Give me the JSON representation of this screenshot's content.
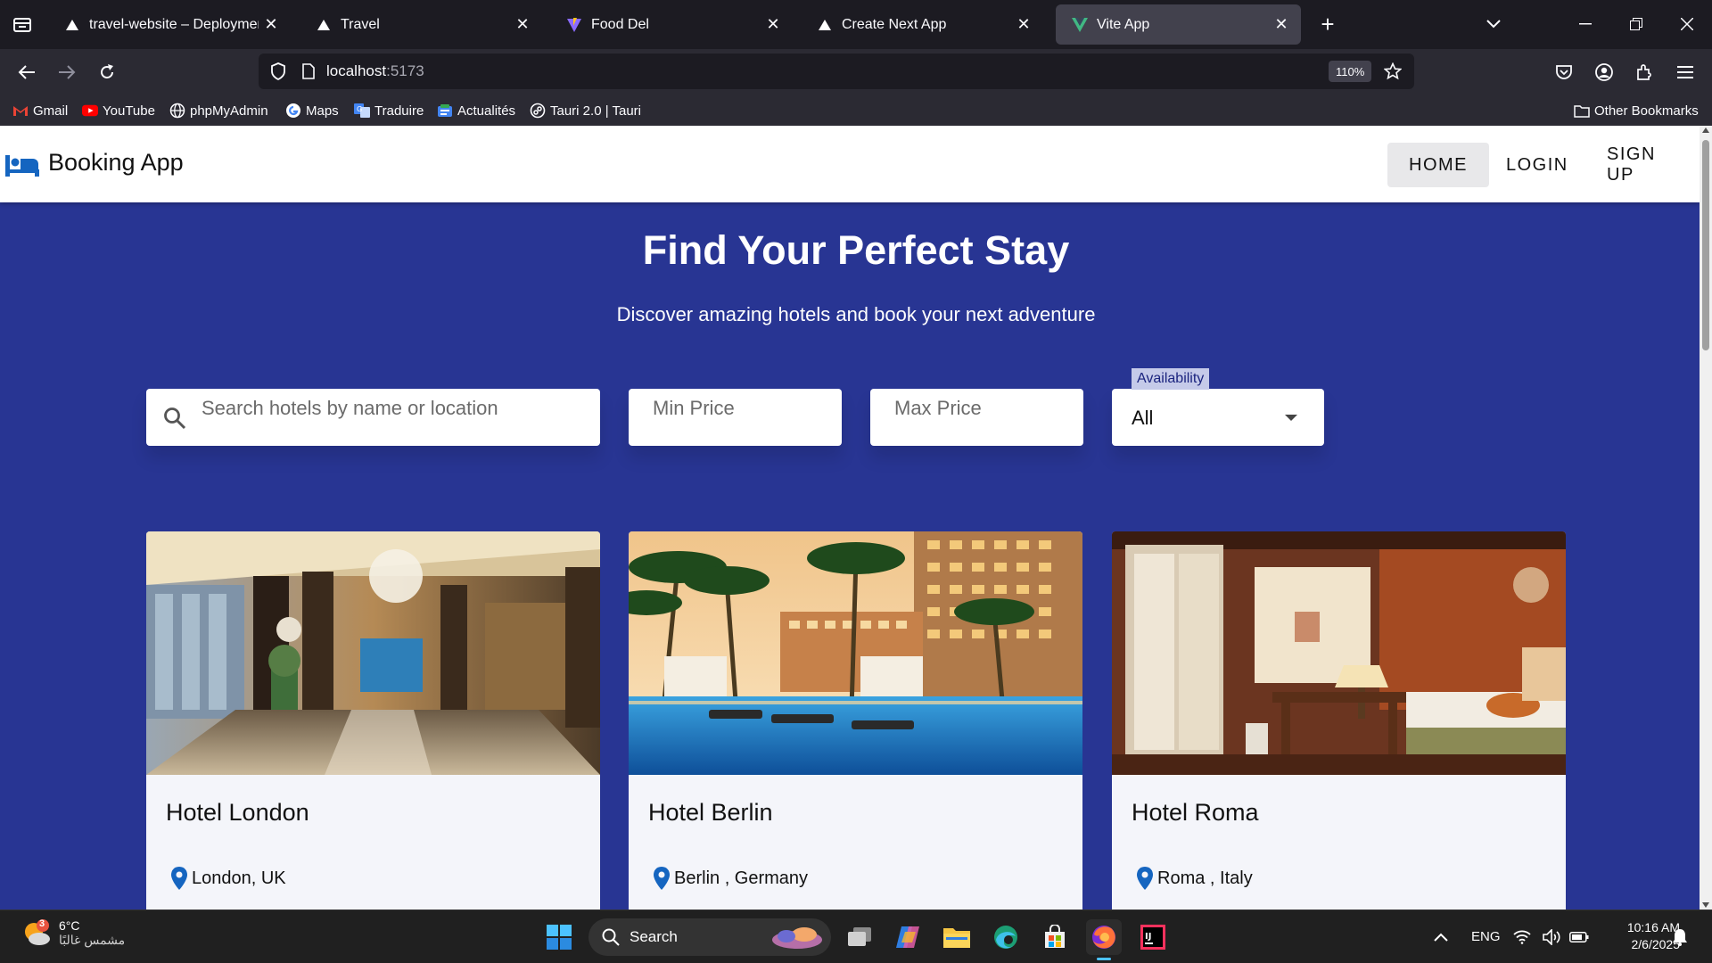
{
  "browser": {
    "tabs": [
      {
        "title": "travel-website – Deployment Sc",
        "icon": "vercel-triangle-icon",
        "active": false
      },
      {
        "title": "Travel",
        "icon": "vercel-triangle-icon",
        "active": false
      },
      {
        "title": "Food Del",
        "icon": "vite-logo-icon",
        "active": false
      },
      {
        "title": "Create Next App",
        "icon": "vercel-triangle-icon",
        "active": false
      },
      {
        "title": "Vite App",
        "icon": "vue-logo-icon",
        "active": true
      }
    ],
    "url_host": "localhost",
    "url_port": ":5173",
    "zoom": "110%",
    "bookmarks": [
      {
        "label": "Gmail",
        "icon": "gmail-icon"
      },
      {
        "label": "YouTube",
        "icon": "youtube-icon"
      },
      {
        "label": "phpMyAdmin",
        "icon": "globe-icon"
      },
      {
        "label": "Maps",
        "icon": "google-icon"
      },
      {
        "label": "Traduire",
        "icon": "translate-icon"
      },
      {
        "label": "Actualités",
        "icon": "news-icon"
      },
      {
        "label": "Tauri 2.0 | Tauri",
        "icon": "tauri-icon"
      }
    ],
    "other_bookmarks": "Other Bookmarks"
  },
  "app": {
    "brand": "Booking App",
    "nav": [
      {
        "label": "HOME",
        "active": true
      },
      {
        "label": "LOGIN",
        "active": false
      },
      {
        "label": "SIGN UP",
        "active": false
      }
    ],
    "hero": {
      "title": "Find Your Perfect Stay",
      "subtitle": "Discover amazing hotels and book your next adventure"
    },
    "filters": {
      "search_placeholder": "Search hotels by name or location",
      "min_price_placeholder": "Min Price",
      "max_price_placeholder": "Max Price",
      "availability_label": "Availability",
      "availability_value": "All"
    },
    "hotels": [
      {
        "name": "Hotel London",
        "location": "London, UK"
      },
      {
        "name": "Hotel Berlin",
        "location": "Berlin , Germany"
      },
      {
        "name": "Hotel Roma",
        "location": "Roma , Italy"
      }
    ],
    "colors": {
      "primary": "#283593",
      "pin": "#1565c0"
    }
  },
  "taskbar": {
    "weather_badge": "3",
    "temperature": "6°C",
    "condition": "مشمس غالبًا",
    "search": "Search",
    "language": "ENG",
    "time": "10:16 AM",
    "date": "2/6/2025"
  }
}
